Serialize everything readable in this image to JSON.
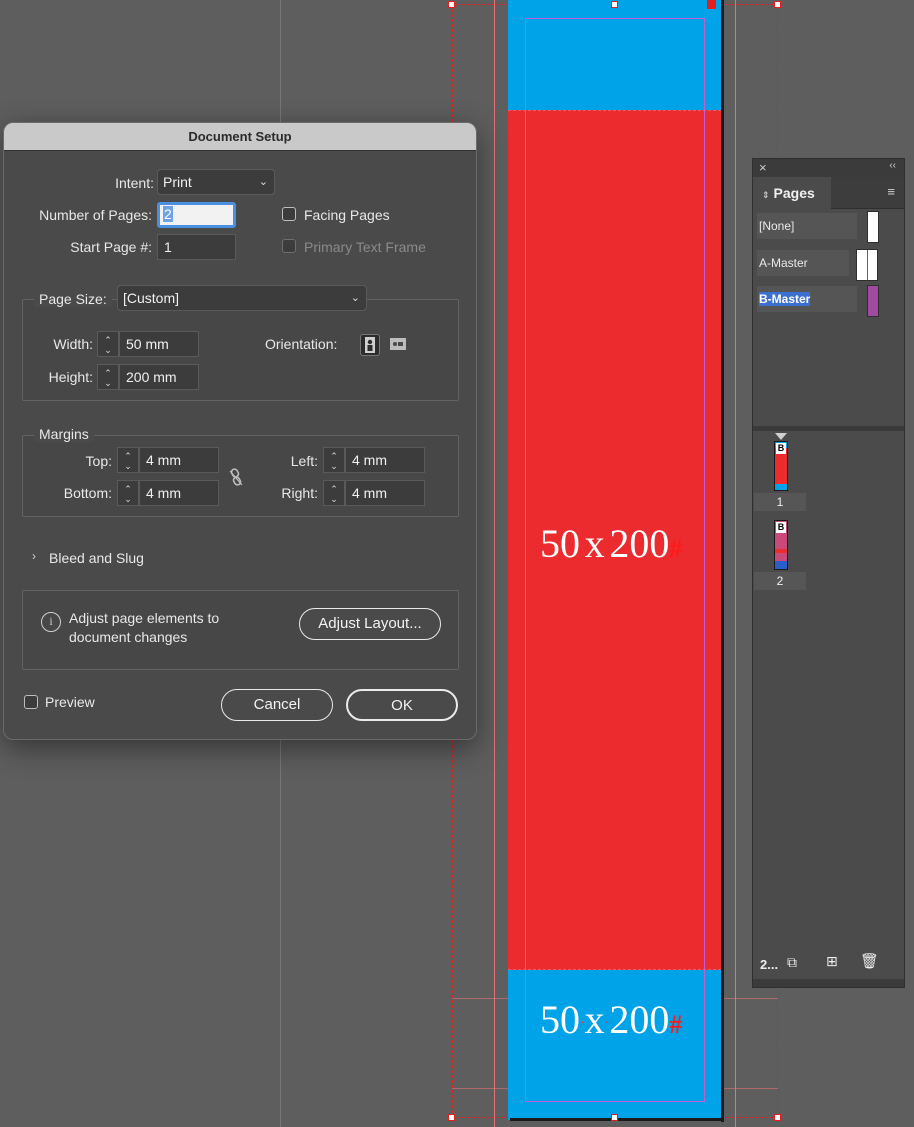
{
  "canvas": {
    "text_top": {
      "a": "50",
      "b": "x",
      "c": "200",
      "mark": "#"
    },
    "text_bottom": {
      "a": "50",
      "b": "x",
      "c": "200",
      "mark": "#"
    }
  },
  "dialog": {
    "title": "Document Setup",
    "intent": {
      "label": "Intent:",
      "value": "Print"
    },
    "num_pages": {
      "label": "Number of Pages:",
      "value": "2"
    },
    "start_page": {
      "label": "Start Page #:",
      "value": "1"
    },
    "facing_pages": {
      "label": "Facing Pages",
      "checked": false
    },
    "primary_text_frame": {
      "label": "Primary Text Frame",
      "checked": false,
      "disabled": true
    },
    "page_size": {
      "label": "Page Size:",
      "value": "[Custom]"
    },
    "width": {
      "label": "Width:",
      "value": "50 mm"
    },
    "height": {
      "label": "Height:",
      "value": "200 mm"
    },
    "orientation": {
      "label": "Orientation:",
      "selected": "portrait"
    },
    "margins": {
      "label": "Margins",
      "top": {
        "label": "Top:",
        "value": "4 mm"
      },
      "bottom": {
        "label": "Bottom:",
        "value": "4 mm"
      },
      "left": {
        "label": "Left:",
        "value": "4 mm"
      },
      "right": {
        "label": "Right:",
        "value": "4 mm"
      }
    },
    "bleed_slug": {
      "label": "Bleed and Slug"
    },
    "adjust": {
      "text_line1": "Adjust page elements to",
      "text_line2": "document changes",
      "button": "Adjust Layout..."
    },
    "preview": {
      "label": "Preview",
      "checked": false
    },
    "cancel": "Cancel",
    "ok": "OK"
  },
  "pages_panel": {
    "title": "Pages",
    "masters": [
      "[None]",
      "A-Master",
      "B-Master"
    ],
    "selected_master": "B-Master",
    "pages": [
      {
        "number": "1",
        "master_prefix": "B"
      },
      {
        "number": "2",
        "master_prefix": "B"
      }
    ],
    "footer_label": "2..."
  },
  "colors": {
    "page_cyan": "#00a2e8",
    "page_red": "#ec2b2f",
    "selection": "#4a8fe0"
  }
}
